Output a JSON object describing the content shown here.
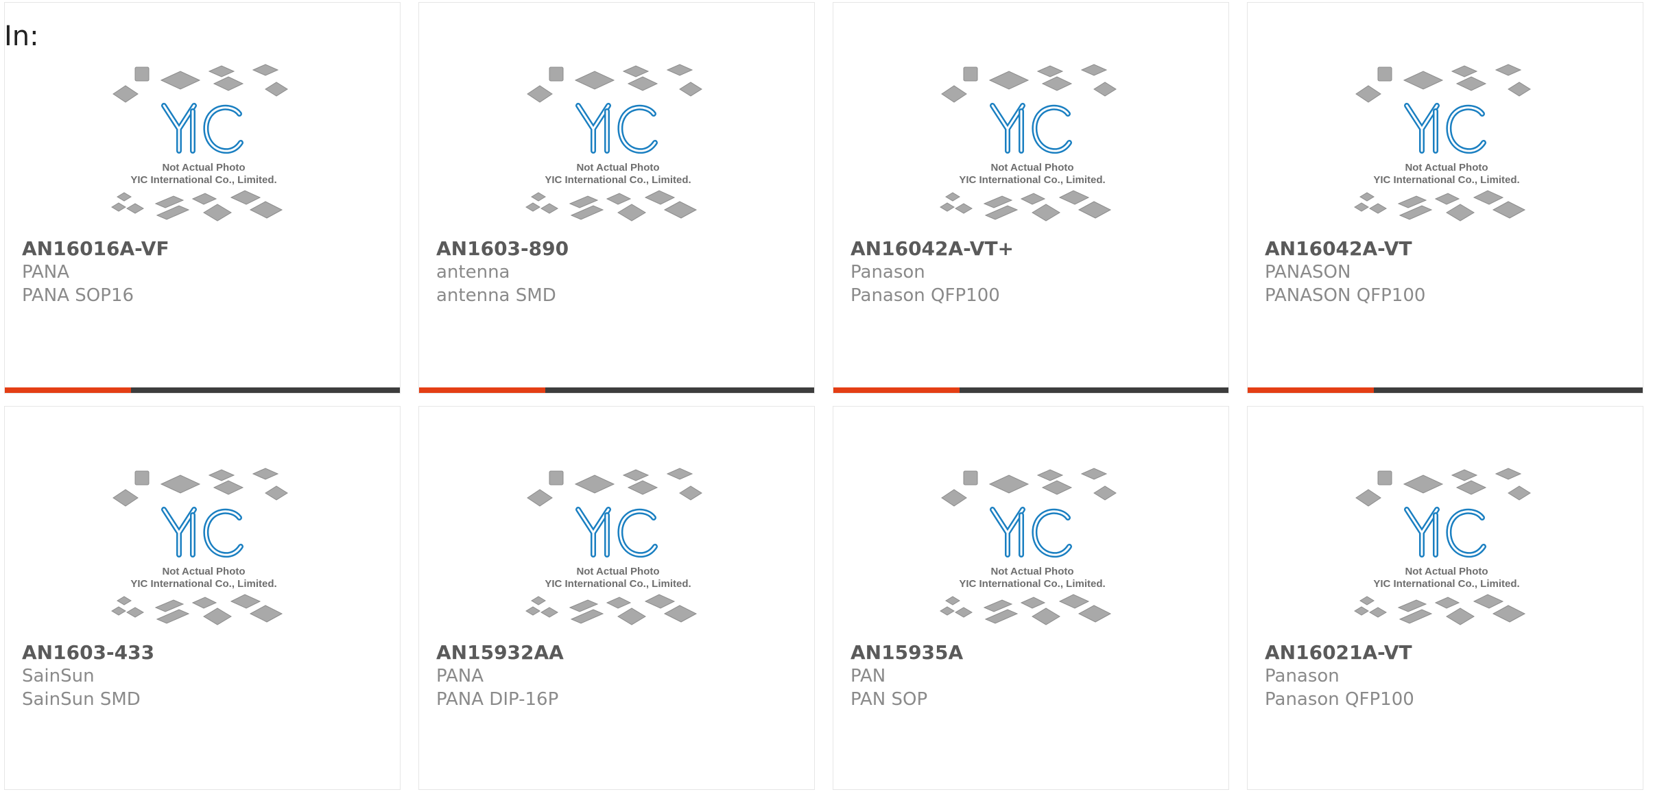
{
  "header": {
    "label": "In:"
  },
  "placeholder": {
    "line1": "Not Actual Photo",
    "line2": "YIC International Co., Limited.",
    "logo": "YIC"
  },
  "colors": {
    "accent": "#e43e14",
    "bar": "#3d3d3d",
    "logo": "#1a7fc1"
  },
  "products": [
    {
      "part": "AN16016A-VF",
      "maker": "PANA",
      "package": "PANA SOP16"
    },
    {
      "part": "AN1603-890",
      "maker": "antenna",
      "package": "antenna SMD"
    },
    {
      "part": "AN16042A-VT+",
      "maker": "Panason",
      "package": "Panason QFP100"
    },
    {
      "part": "AN16042A-VT",
      "maker": "PANASON",
      "package": "PANASON QFP100"
    },
    {
      "part": "AN1603-433",
      "maker": "SainSun",
      "package": "SainSun SMD"
    },
    {
      "part": "AN15932AA",
      "maker": "PANA",
      "package": "PANA DIP-16P"
    },
    {
      "part": "AN15935A",
      "maker": "PAN",
      "package": "PAN SOP"
    },
    {
      "part": "AN16021A-VT",
      "maker": "Panason",
      "package": "Panason QFP100"
    }
  ]
}
